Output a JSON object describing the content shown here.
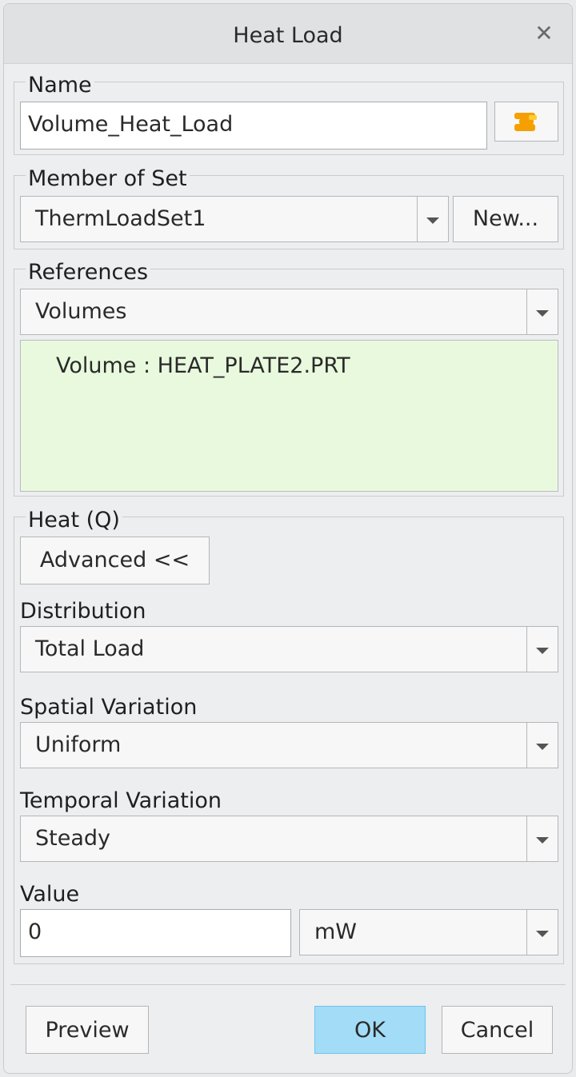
{
  "dialog": {
    "title": "Heat Load",
    "close_icon": "close-icon"
  },
  "name_group": {
    "legend": "Name",
    "value": "Volume_Heat_Load",
    "color_button_icon": "color-swatch-icon",
    "accent_color": "#f5a000"
  },
  "set_group": {
    "legend": "Member of Set",
    "selected": "ThermLoadSet1",
    "new_button": "New..."
  },
  "references_group": {
    "legend": "References",
    "type_selected": "Volumes",
    "items": [
      "Volume : HEAT_PLATE2.PRT"
    ],
    "list_bg": "#e9f9de"
  },
  "heat_group": {
    "legend": "Heat (Q)",
    "advanced_button": "Advanced <<",
    "distribution_label": "Distribution",
    "distribution_value": "Total Load",
    "spatial_label": "Spatial Variation",
    "spatial_value": "Uniform",
    "temporal_label": "Temporal Variation",
    "temporal_value": "Steady",
    "value_label": "Value",
    "value": "0",
    "unit": "mW"
  },
  "footer": {
    "preview": "Preview",
    "ok": "OK",
    "cancel": "Cancel",
    "ok_color": "#a3dcf7"
  }
}
